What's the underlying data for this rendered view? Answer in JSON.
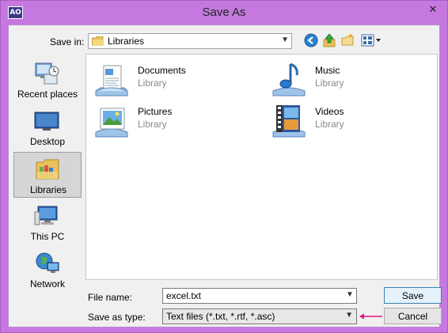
{
  "window": {
    "app_icon_text": "AO",
    "title": "Save As",
    "close_glyph": "✕",
    "colors": {
      "frame": "#c579e0",
      "accent_arrow": "#e0147a"
    }
  },
  "toolbar": {
    "save_in_label": "Save in:",
    "save_in_value": "Libraries",
    "icons": [
      "back-icon",
      "up-folder-icon",
      "new-folder-icon",
      "views-menu-icon"
    ]
  },
  "places": [
    {
      "label": "Recent places",
      "icon": "recent-places-icon"
    },
    {
      "label": "Desktop",
      "icon": "desktop-icon"
    },
    {
      "label": "Libraries",
      "icon": "libraries-icon",
      "selected": true
    },
    {
      "label": "This PC",
      "icon": "this-pc-icon"
    },
    {
      "label": "Network",
      "icon": "network-icon"
    }
  ],
  "libraries": [
    {
      "name": "Documents",
      "type": "Library",
      "icon": "documents-library-icon"
    },
    {
      "name": "Music",
      "type": "Library",
      "icon": "music-library-icon"
    },
    {
      "name": "Pictures",
      "type": "Library",
      "icon": "pictures-library-icon"
    },
    {
      "name": "Videos",
      "type": "Library",
      "icon": "videos-library-icon"
    }
  ],
  "form": {
    "file_name_label": "File name:",
    "file_name_value": "excel.txt",
    "save_as_type_label": "Save as type:",
    "save_as_type_value": "Text files (*.txt, *.rtf, *.asc)"
  },
  "buttons": {
    "save": "Save",
    "cancel": "Cancel"
  }
}
